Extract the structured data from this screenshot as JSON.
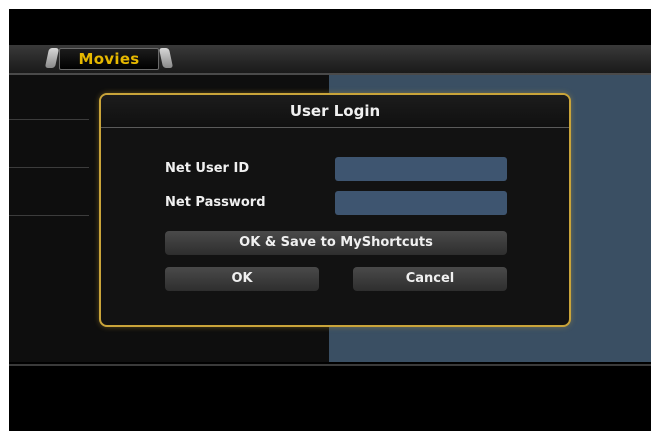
{
  "header": {
    "tab_label": "Movies"
  },
  "dialog": {
    "title": "User Login",
    "user_id_label": "Net User ID",
    "user_id_value": "",
    "password_label": "Net Password",
    "password_value": "",
    "save_button_label": "OK & Save to MyShortcuts",
    "ok_button_label": "OK",
    "cancel_button_label": "Cancel"
  },
  "colors": {
    "accent_gold": "#e6b800",
    "dialog_border": "#c9a43a",
    "input_fill": "#3e5570",
    "panel_blue": "#3a4f63"
  }
}
